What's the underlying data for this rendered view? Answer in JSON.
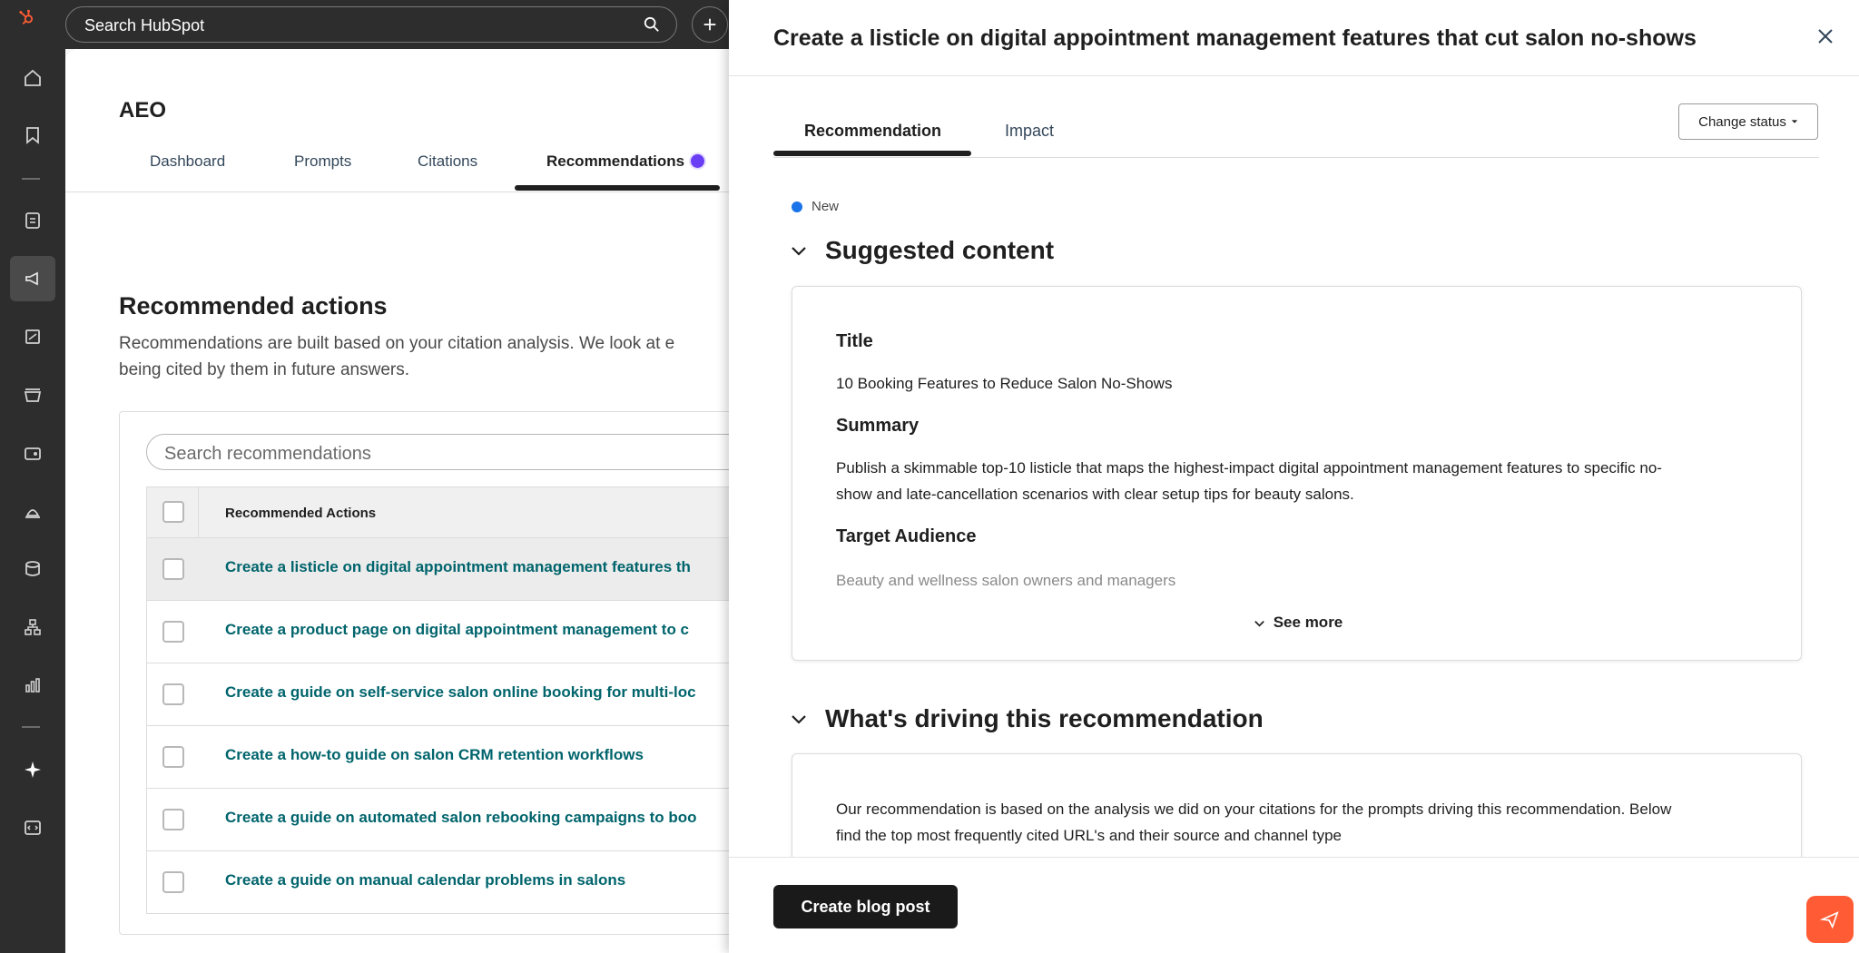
{
  "topbar": {
    "search_placeholder": "Search HubSpot"
  },
  "main": {
    "title": "AEO",
    "tabs": [
      {
        "label": "Dashboard"
      },
      {
        "label": "Prompts"
      },
      {
        "label": "Citations"
      },
      {
        "label": "Recommendations"
      }
    ],
    "active_tab": "Recommendations",
    "section_heading": "Recommended actions",
    "section_desc_line1": "Recommendations are built based on your citation analysis. We look at e",
    "section_desc_line2": "being cited by them in future answers.",
    "search_placeholder": "Search recommendations",
    "table": {
      "column_header": "Recommended Actions",
      "rows": [
        "Create a listicle on digital appointment management features th",
        "Create a product page on digital appointment management to c",
        "Create a guide on self-service salon online booking for multi-loc",
        "Create a how-to guide on salon CRM retention workflows",
        "Create a guide on automated salon rebooking campaigns to boo",
        "Create a guide on manual calendar problems in salons"
      ]
    }
  },
  "panel": {
    "title": "Create a listicle on digital appointment management features that cut salon no-shows",
    "tabs": [
      {
        "label": "Recommendation"
      },
      {
        "label": "Impact"
      }
    ],
    "change_status_label": "Change status",
    "status": "New",
    "suggested_content": {
      "heading": "Suggested content",
      "title_label": "Title",
      "title_value": "10 Booking Features to Reduce Salon No-Shows",
      "summary_label": "Summary",
      "summary_line1": "Publish a skimmable top-10 listicle that maps the highest-impact digital appointment management features to specific no-",
      "summary_line2": "show and late-cancellation scenarios with clear setup tips for beauty salons.",
      "audience_label": "Target Audience",
      "audience_value": "Beauty and wellness salon owners and managers",
      "see_more_label": "See more"
    },
    "driving": {
      "heading": "What's driving this recommendation",
      "line1": "Our recommendation is based on the analysis we did on your citations for the prompts driving this recommendation. Below",
      "line2": "find the top most frequently cited URL's and their source and channel type"
    },
    "cta_label": "Create blog post"
  },
  "colors": {
    "rail_bg": "#2d2d2d",
    "link_teal": "#00646c",
    "badge_purple": "#6a3ef5",
    "status_blue": "#1a73e8",
    "help_orange": "#ff5c35",
    "hubspot_orange": "#ff5c35"
  },
  "icons": {
    "rail": [
      "hubspot-logo",
      "home-icon",
      "bookmark-icon",
      "contacts-icon",
      "marketing-megaphone-icon",
      "content-icon",
      "commerce-icon",
      "payments-icon",
      "service-icon",
      "data-icon",
      "automation-icon",
      "reporting-icon",
      "ai-sparkle-icon",
      "developer-icon"
    ]
  }
}
